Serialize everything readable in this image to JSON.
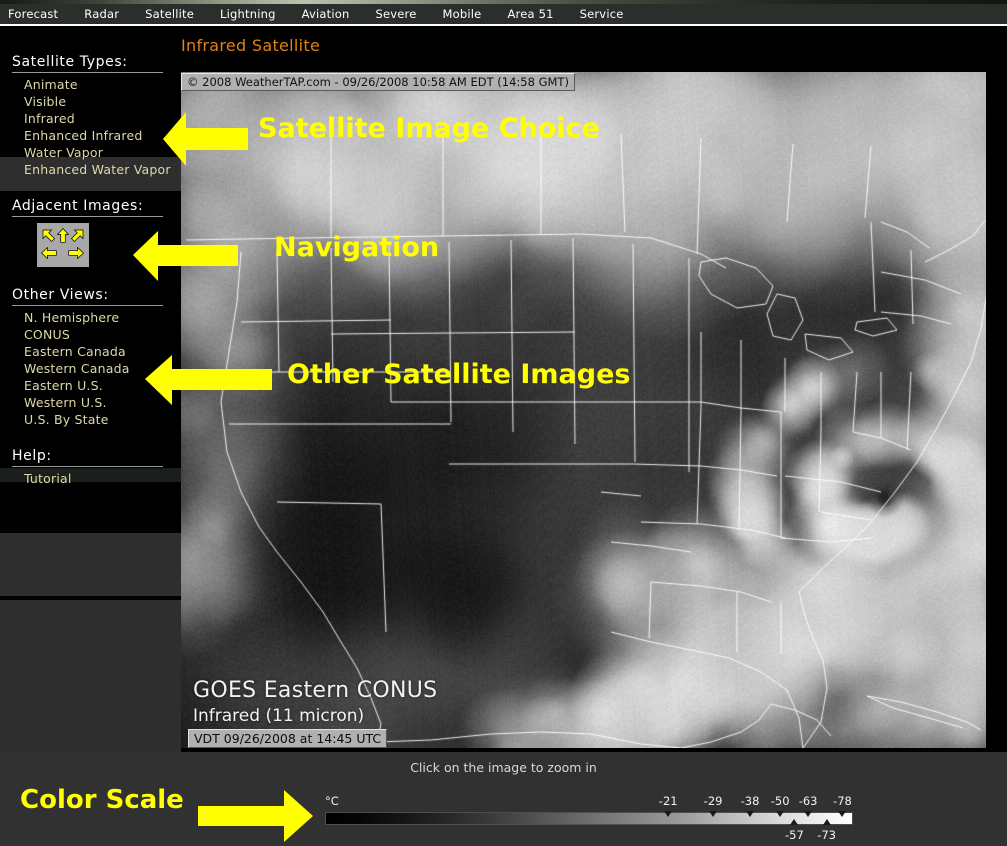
{
  "nav": {
    "items": [
      {
        "label": "Forecast"
      },
      {
        "label": "Radar"
      },
      {
        "label": "Satellite"
      },
      {
        "label": "Lightning"
      },
      {
        "label": "Aviation"
      },
      {
        "label": "Severe"
      },
      {
        "label": "Mobile"
      },
      {
        "label": "Area 51"
      },
      {
        "label": "Service"
      }
    ]
  },
  "sidebar": {
    "satellite_types": {
      "heading": "Satellite Types:",
      "items": [
        {
          "label": "Animate"
        },
        {
          "label": "Visible"
        },
        {
          "label": "Infrared"
        },
        {
          "label": "Enhanced Infrared"
        },
        {
          "label": "Water Vapor"
        },
        {
          "label": "Enhanced Water Vapor"
        }
      ]
    },
    "adjacent_images": {
      "heading": "Adjacent Images:",
      "pad_name": "navigation-arrow-pad",
      "arrows": [
        "up-left",
        "up",
        "up-right",
        "left",
        "right"
      ]
    },
    "other_views": {
      "heading": "Other Views:",
      "items": [
        {
          "label": "N. Hemisphere"
        },
        {
          "label": "CONUS"
        },
        {
          "label": "Eastern Canada"
        },
        {
          "label": "Western Canada"
        },
        {
          "label": "Eastern U.S."
        },
        {
          "label": "Western U.S."
        },
        {
          "label": "U.S. By State"
        }
      ]
    },
    "help": {
      "heading": "Help:",
      "items": [
        {
          "label": "Tutorial"
        }
      ]
    }
  },
  "main": {
    "title": "Infrared Satellite",
    "copyright_bar": "© 2008 WeatherTAP.com - 09/26/2008 10:58 AM EDT (14:58 GMT)",
    "image_caption_title": "GOES Eastern CONUS",
    "image_caption_band": "Infrared (11 micron)",
    "image_caption_vdt": "VDT 09/26/2008 at 14:45 UTC",
    "zoom_hint": "Click on the image to zoom in"
  },
  "color_scale": {
    "unit": "°C",
    "ticks_top": [
      {
        "label": "-21",
        "pos_pct": 65.0
      },
      {
        "label": "-29",
        "pos_pct": 73.5
      },
      {
        "label": "-38",
        "pos_pct": 80.5
      },
      {
        "label": "-50",
        "pos_pct": 86.2
      },
      {
        "label": "-63",
        "pos_pct": 91.5
      },
      {
        "label": "-78",
        "pos_pct": 98.0
      }
    ],
    "ticks_bottom": [
      {
        "label": "-57",
        "pos_pct": 88.9
      },
      {
        "label": "-73",
        "pos_pct": 95.0
      }
    ],
    "gradient_from": "#000000",
    "gradient_to": "#ffffff"
  },
  "annotations": [
    {
      "text": "Satellite Image Choice",
      "name": "annotation-satellite-image-choice"
    },
    {
      "text": "Navigation",
      "name": "annotation-navigation"
    },
    {
      "text": "Other Satellite Images",
      "name": "annotation-other-satellite-images"
    },
    {
      "text": "Color Scale",
      "name": "annotation-color-scale"
    }
  ],
  "colors": {
    "annotation_yellow": "#ffff00",
    "title_orange": "#e08214",
    "link_tan": "#ded8a8",
    "nav_bar_bg": "#2b2f2b",
    "scale_zone_bg": "#313131"
  }
}
